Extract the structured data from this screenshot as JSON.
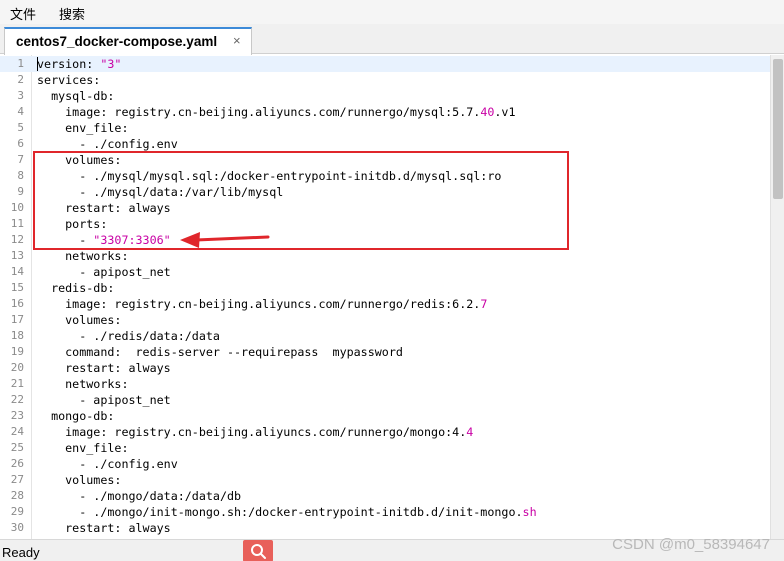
{
  "menu": {
    "file": "文件",
    "search": "搜索"
  },
  "tab": {
    "title": "centos7_docker-compose.yaml",
    "close": "×"
  },
  "editor": {
    "lines": [
      {
        "n": "1",
        "parts": [
          [
            "",
            "version: "
          ],
          [
            "str",
            "\"3\""
          ]
        ]
      },
      {
        "n": "2",
        "parts": [
          [
            "",
            "services:"
          ]
        ]
      },
      {
        "n": "3",
        "parts": [
          [
            "",
            "  mysql-db:"
          ]
        ]
      },
      {
        "n": "4",
        "parts": [
          [
            "",
            "    image: registry.cn-beijing.aliyuncs.com/runnergo/mysql:5.7."
          ],
          [
            "num",
            "40"
          ],
          [
            "",
            ".v1"
          ]
        ]
      },
      {
        "n": "5",
        "parts": [
          [
            "",
            "    env_file:"
          ]
        ]
      },
      {
        "n": "6",
        "parts": [
          [
            "",
            "      - ./config.env"
          ]
        ]
      },
      {
        "n": "7",
        "parts": [
          [
            "",
            "    volumes:"
          ]
        ]
      },
      {
        "n": "8",
        "parts": [
          [
            "",
            "      - ./mysql/mysql.sql:/docker-entrypoint-initdb.d/mysql.sql:ro"
          ]
        ]
      },
      {
        "n": "9",
        "parts": [
          [
            "",
            "      - ./mysql/data:/var/lib/mysql"
          ]
        ]
      },
      {
        "n": "10",
        "parts": [
          [
            "",
            "    restart: always"
          ]
        ]
      },
      {
        "n": "11",
        "parts": [
          [
            "",
            "    ports:"
          ]
        ]
      },
      {
        "n": "12",
        "parts": [
          [
            "",
            "      - "
          ],
          [
            "str",
            "\"3307:3306\""
          ]
        ]
      },
      {
        "n": "13",
        "parts": [
          [
            "",
            "    networks:"
          ]
        ]
      },
      {
        "n": "14",
        "parts": [
          [
            "",
            "      - apipost_net"
          ]
        ]
      },
      {
        "n": "15",
        "parts": [
          [
            "",
            "  redis-db:"
          ]
        ]
      },
      {
        "n": "16",
        "parts": [
          [
            "",
            "    image: registry.cn-beijing.aliyuncs.com/runnergo/redis:6.2."
          ],
          [
            "num",
            "7"
          ]
        ]
      },
      {
        "n": "17",
        "parts": [
          [
            "",
            "    volumes:"
          ]
        ]
      },
      {
        "n": "18",
        "parts": [
          [
            "",
            "      - ./redis/data:/data"
          ]
        ]
      },
      {
        "n": "19",
        "parts": [
          [
            "",
            "    command:  redis-server --requirepass  mypassword"
          ]
        ]
      },
      {
        "n": "20",
        "parts": [
          [
            "",
            "    restart: always"
          ]
        ]
      },
      {
        "n": "21",
        "parts": [
          [
            "",
            "    networks:"
          ]
        ]
      },
      {
        "n": "22",
        "parts": [
          [
            "",
            "      - apipost_net"
          ]
        ]
      },
      {
        "n": "23",
        "parts": [
          [
            "",
            "  mongo-db:"
          ]
        ]
      },
      {
        "n": "24",
        "parts": [
          [
            "",
            "    image: registry.cn-beijing.aliyuncs.com/runnergo/mongo:4."
          ],
          [
            "num",
            "4"
          ]
        ]
      },
      {
        "n": "25",
        "parts": [
          [
            "",
            "    env_file:"
          ]
        ]
      },
      {
        "n": "26",
        "parts": [
          [
            "",
            "      - ./config.env"
          ]
        ]
      },
      {
        "n": "27",
        "parts": [
          [
            "",
            "    volumes:"
          ]
        ]
      },
      {
        "n": "28",
        "parts": [
          [
            "",
            "      - ./mongo/data:/data/db"
          ]
        ]
      },
      {
        "n": "29",
        "parts": [
          [
            "",
            "      - ./mongo/init-mongo.sh:/docker-entrypoint-initdb.d/init-mongo."
          ],
          [
            "tail",
            "sh"
          ]
        ]
      },
      {
        "n": "30",
        "parts": [
          [
            "",
            "    restart: always"
          ]
        ]
      }
    ]
  },
  "status": {
    "text": "Ready"
  },
  "watermark": "CSDN @m0_58394647",
  "colors": {
    "string": "#c800a4",
    "annotation": "#e0262b",
    "tab_accent": "#3c8ad8"
  },
  "icons": {
    "search": "search-icon",
    "close": "close-icon"
  }
}
